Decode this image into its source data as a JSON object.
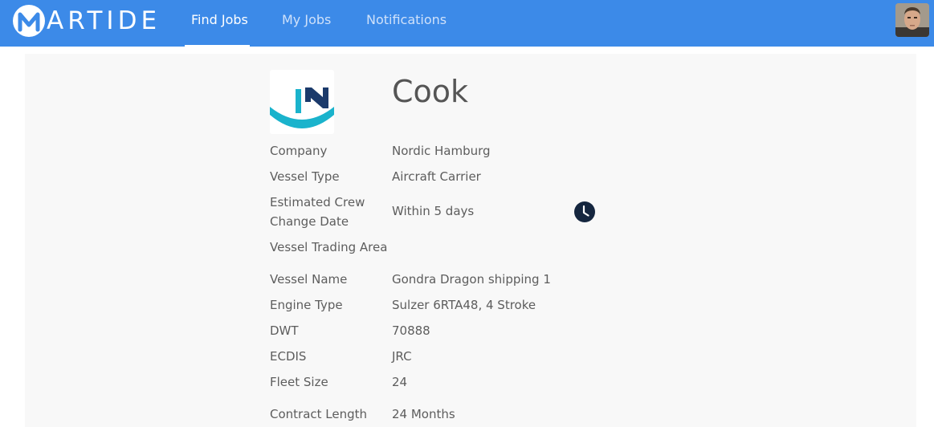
{
  "brand": {
    "logo_letter": "M",
    "logo_rest": "ARTIDE"
  },
  "nav": {
    "items": [
      {
        "label": "Find Jobs",
        "active": true
      },
      {
        "label": "My Jobs",
        "active": false
      },
      {
        "label": "Notifications",
        "active": false
      }
    ]
  },
  "job": {
    "title": "Cook",
    "company_logo_icon": "nordic-hamburg-logo-icon",
    "details": [
      {
        "label": "Company",
        "value": "Nordic Hamburg"
      },
      {
        "label": "Vessel Type",
        "value": "Aircraft Carrier"
      },
      {
        "label": "Estimated Crew Change Date",
        "label_line1": "Estimated Crew",
        "label_line2": "Change Date",
        "value": "Within 5 days"
      },
      {
        "label": "Vessel Trading Area",
        "value": ""
      },
      {
        "label": "Vessel Name",
        "value": "Gondra Dragon shipping 1"
      },
      {
        "label": "Engine Type",
        "value": "Sulzer 6RTA48, 4 Stroke"
      },
      {
        "label": "DWT",
        "value": "70888"
      },
      {
        "label": "ECDIS",
        "value": "JRC"
      },
      {
        "label": "Fleet Size",
        "value": "24"
      },
      {
        "label": "Contract Length",
        "value": "24 Months"
      }
    ]
  },
  "colors": {
    "topbar": "#3c8ae8",
    "panel": "#f8f8f8",
    "logo_cyan": "#1ab3cc",
    "logo_navy": "#1b3a6b",
    "clock": "#15263f"
  }
}
